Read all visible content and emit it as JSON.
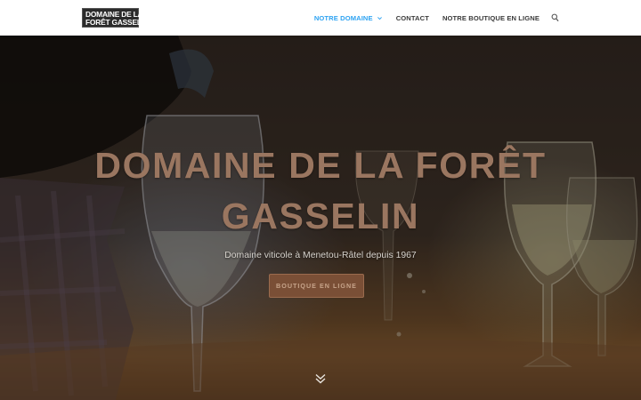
{
  "header": {
    "logo_lines": [
      "DOMAINE DE LA",
      "FORÊT GASSELIN"
    ],
    "nav": [
      {
        "label": "NOTRE DOMAINE",
        "active": true,
        "has_dropdown": true
      },
      {
        "label": "CONTACT",
        "active": false
      },
      {
        "label": "NOTRE BOUTIQUE EN LIGNE",
        "active": false
      }
    ],
    "search_icon": "search-icon",
    "accent_color": "#2ea3f2"
  },
  "hero": {
    "title_lines": [
      "DOMAINE DE LA FORÊT",
      "GASSELIN"
    ],
    "subtitle": "Domaine viticole à Menetou-Râtel depuis 1967",
    "button_label": "BOUTIQUE EN LIGNE",
    "scroll_icon": "double-chevron-down-icon",
    "title_color": "#9a7660",
    "button_color": "#7a4f36"
  }
}
